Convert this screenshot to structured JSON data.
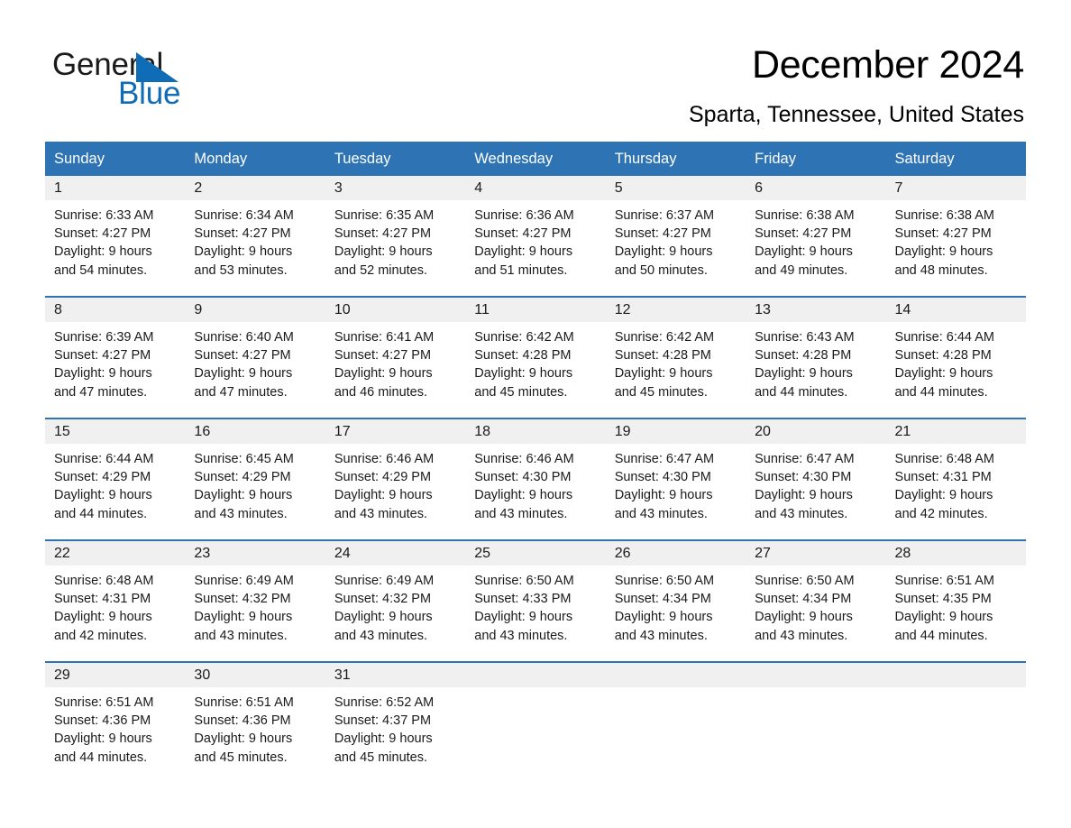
{
  "brand": {
    "name_part1": "General",
    "name_part2": "Blue",
    "triangle_icon": "triangle-icon",
    "accent_color": "#0f6cb6"
  },
  "header": {
    "month_title": "December 2024",
    "location": "Sparta, Tennessee, United States"
  },
  "theme": {
    "header_blue": "#2e74b5",
    "row_separator_blue": "#2e74b5",
    "daynum_band_gray": "#f0f0f0",
    "text_color": "#1a1a1a"
  },
  "calendar": {
    "weekday_headers": [
      "Sunday",
      "Monday",
      "Tuesday",
      "Wednesday",
      "Thursday",
      "Friday",
      "Saturday"
    ],
    "weeks": [
      [
        {
          "day": "1",
          "sunrise": "Sunrise: 6:33 AM",
          "sunset": "Sunset: 4:27 PM",
          "daylight_line1": "Daylight: 9 hours",
          "daylight_line2": "and 54 minutes."
        },
        {
          "day": "2",
          "sunrise": "Sunrise: 6:34 AM",
          "sunset": "Sunset: 4:27 PM",
          "daylight_line1": "Daylight: 9 hours",
          "daylight_line2": "and 53 minutes."
        },
        {
          "day": "3",
          "sunrise": "Sunrise: 6:35 AM",
          "sunset": "Sunset: 4:27 PM",
          "daylight_line1": "Daylight: 9 hours",
          "daylight_line2": "and 52 minutes."
        },
        {
          "day": "4",
          "sunrise": "Sunrise: 6:36 AM",
          "sunset": "Sunset: 4:27 PM",
          "daylight_line1": "Daylight: 9 hours",
          "daylight_line2": "and 51 minutes."
        },
        {
          "day": "5",
          "sunrise": "Sunrise: 6:37 AM",
          "sunset": "Sunset: 4:27 PM",
          "daylight_line1": "Daylight: 9 hours",
          "daylight_line2": "and 50 minutes."
        },
        {
          "day": "6",
          "sunrise": "Sunrise: 6:38 AM",
          "sunset": "Sunset: 4:27 PM",
          "daylight_line1": "Daylight: 9 hours",
          "daylight_line2": "and 49 minutes."
        },
        {
          "day": "7",
          "sunrise": "Sunrise: 6:38 AM",
          "sunset": "Sunset: 4:27 PM",
          "daylight_line1": "Daylight: 9 hours",
          "daylight_line2": "and 48 minutes."
        }
      ],
      [
        {
          "day": "8",
          "sunrise": "Sunrise: 6:39 AM",
          "sunset": "Sunset: 4:27 PM",
          "daylight_line1": "Daylight: 9 hours",
          "daylight_line2": "and 47 minutes."
        },
        {
          "day": "9",
          "sunrise": "Sunrise: 6:40 AM",
          "sunset": "Sunset: 4:27 PM",
          "daylight_line1": "Daylight: 9 hours",
          "daylight_line2": "and 47 minutes."
        },
        {
          "day": "10",
          "sunrise": "Sunrise: 6:41 AM",
          "sunset": "Sunset: 4:27 PM",
          "daylight_line1": "Daylight: 9 hours",
          "daylight_line2": "and 46 minutes."
        },
        {
          "day": "11",
          "sunrise": "Sunrise: 6:42 AM",
          "sunset": "Sunset: 4:28 PM",
          "daylight_line1": "Daylight: 9 hours",
          "daylight_line2": "and 45 minutes."
        },
        {
          "day": "12",
          "sunrise": "Sunrise: 6:42 AM",
          "sunset": "Sunset: 4:28 PM",
          "daylight_line1": "Daylight: 9 hours",
          "daylight_line2": "and 45 minutes."
        },
        {
          "day": "13",
          "sunrise": "Sunrise: 6:43 AM",
          "sunset": "Sunset: 4:28 PM",
          "daylight_line1": "Daylight: 9 hours",
          "daylight_line2": "and 44 minutes."
        },
        {
          "day": "14",
          "sunrise": "Sunrise: 6:44 AM",
          "sunset": "Sunset: 4:28 PM",
          "daylight_line1": "Daylight: 9 hours",
          "daylight_line2": "and 44 minutes."
        }
      ],
      [
        {
          "day": "15",
          "sunrise": "Sunrise: 6:44 AM",
          "sunset": "Sunset: 4:29 PM",
          "daylight_line1": "Daylight: 9 hours",
          "daylight_line2": "and 44 minutes."
        },
        {
          "day": "16",
          "sunrise": "Sunrise: 6:45 AM",
          "sunset": "Sunset: 4:29 PM",
          "daylight_line1": "Daylight: 9 hours",
          "daylight_line2": "and 43 minutes."
        },
        {
          "day": "17",
          "sunrise": "Sunrise: 6:46 AM",
          "sunset": "Sunset: 4:29 PM",
          "daylight_line1": "Daylight: 9 hours",
          "daylight_line2": "and 43 minutes."
        },
        {
          "day": "18",
          "sunrise": "Sunrise: 6:46 AM",
          "sunset": "Sunset: 4:30 PM",
          "daylight_line1": "Daylight: 9 hours",
          "daylight_line2": "and 43 minutes."
        },
        {
          "day": "19",
          "sunrise": "Sunrise: 6:47 AM",
          "sunset": "Sunset: 4:30 PM",
          "daylight_line1": "Daylight: 9 hours",
          "daylight_line2": "and 43 minutes."
        },
        {
          "day": "20",
          "sunrise": "Sunrise: 6:47 AM",
          "sunset": "Sunset: 4:30 PM",
          "daylight_line1": "Daylight: 9 hours",
          "daylight_line2": "and 43 minutes."
        },
        {
          "day": "21",
          "sunrise": "Sunrise: 6:48 AM",
          "sunset": "Sunset: 4:31 PM",
          "daylight_line1": "Daylight: 9 hours",
          "daylight_line2": "and 42 minutes."
        }
      ],
      [
        {
          "day": "22",
          "sunrise": "Sunrise: 6:48 AM",
          "sunset": "Sunset: 4:31 PM",
          "daylight_line1": "Daylight: 9 hours",
          "daylight_line2": "and 42 minutes."
        },
        {
          "day": "23",
          "sunrise": "Sunrise: 6:49 AM",
          "sunset": "Sunset: 4:32 PM",
          "daylight_line1": "Daylight: 9 hours",
          "daylight_line2": "and 43 minutes."
        },
        {
          "day": "24",
          "sunrise": "Sunrise: 6:49 AM",
          "sunset": "Sunset: 4:32 PM",
          "daylight_line1": "Daylight: 9 hours",
          "daylight_line2": "and 43 minutes."
        },
        {
          "day": "25",
          "sunrise": "Sunrise: 6:50 AM",
          "sunset": "Sunset: 4:33 PM",
          "daylight_line1": "Daylight: 9 hours",
          "daylight_line2": "and 43 minutes."
        },
        {
          "day": "26",
          "sunrise": "Sunrise: 6:50 AM",
          "sunset": "Sunset: 4:34 PM",
          "daylight_line1": "Daylight: 9 hours",
          "daylight_line2": "and 43 minutes."
        },
        {
          "day": "27",
          "sunrise": "Sunrise: 6:50 AM",
          "sunset": "Sunset: 4:34 PM",
          "daylight_line1": "Daylight: 9 hours",
          "daylight_line2": "and 43 minutes."
        },
        {
          "day": "28",
          "sunrise": "Sunrise: 6:51 AM",
          "sunset": "Sunset: 4:35 PM",
          "daylight_line1": "Daylight: 9 hours",
          "daylight_line2": "and 44 minutes."
        }
      ],
      [
        {
          "day": "29",
          "sunrise": "Sunrise: 6:51 AM",
          "sunset": "Sunset: 4:36 PM",
          "daylight_line1": "Daylight: 9 hours",
          "daylight_line2": "and 44 minutes."
        },
        {
          "day": "30",
          "sunrise": "Sunrise: 6:51 AM",
          "sunset": "Sunset: 4:36 PM",
          "daylight_line1": "Daylight: 9 hours",
          "daylight_line2": "and 45 minutes."
        },
        {
          "day": "31",
          "sunrise": "Sunrise: 6:52 AM",
          "sunset": "Sunset: 4:37 PM",
          "daylight_line1": "Daylight: 9 hours",
          "daylight_line2": "and 45 minutes."
        },
        {
          "day": "",
          "sunrise": "",
          "sunset": "",
          "daylight_line1": "",
          "daylight_line2": ""
        },
        {
          "day": "",
          "sunrise": "",
          "sunset": "",
          "daylight_line1": "",
          "daylight_line2": ""
        },
        {
          "day": "",
          "sunrise": "",
          "sunset": "",
          "daylight_line1": "",
          "daylight_line2": ""
        },
        {
          "day": "",
          "sunrise": "",
          "sunset": "",
          "daylight_line1": "",
          "daylight_line2": ""
        }
      ]
    ]
  }
}
